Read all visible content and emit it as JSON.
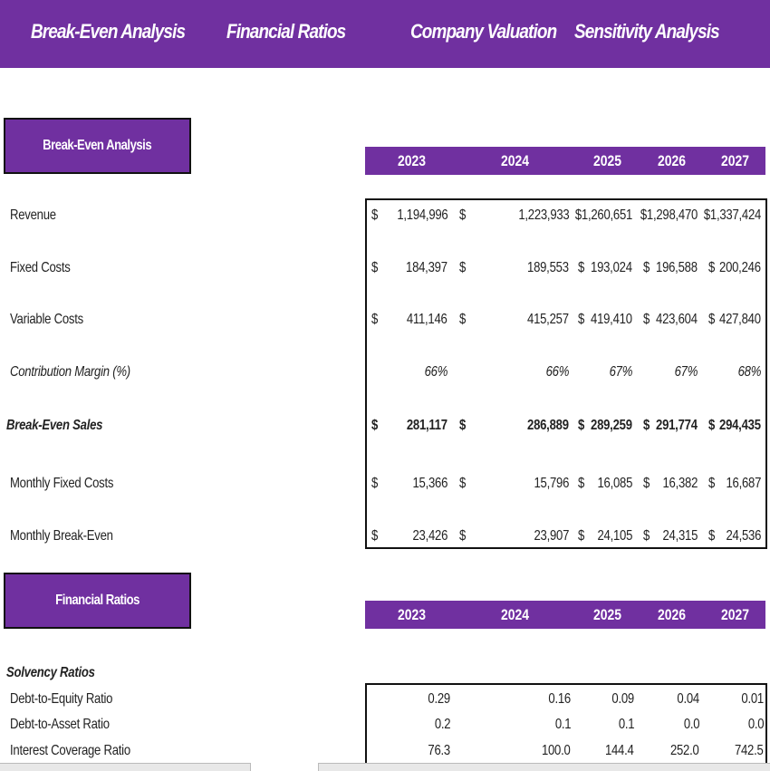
{
  "nav": {
    "items": [
      {
        "label": "Break-Even Analysis"
      },
      {
        "label": "Financial Ratios"
      },
      {
        "label": "Company Valuation"
      },
      {
        "label": "Sensitivity Analysis"
      }
    ]
  },
  "colors": {
    "accent": "#7030a0",
    "border": "#111111"
  },
  "break_even": {
    "section_title": "Break-Even Analysis",
    "years": [
      "2023",
      "2024",
      "2025",
      "2026",
      "2027"
    ],
    "rows": [
      {
        "label": "Revenue",
        "style": "normal",
        "currency": true,
        "values": [
          "1,194,996",
          "1,223,933",
          "$1,260,651",
          "$1,298,470",
          "$1,337,424"
        ]
      },
      {
        "label": "Fixed Costs",
        "style": "normal",
        "currency": true,
        "values": [
          "184,397",
          "189,553",
          "193,024",
          "196,588",
          "200,246"
        ]
      },
      {
        "label": "Variable Costs",
        "style": "normal",
        "currency": true,
        "values": [
          "411,146",
          "415,257",
          "419,410",
          "423,604",
          "427,840"
        ]
      },
      {
        "label": "Contribution Margin (%)",
        "style": "italic",
        "currency": false,
        "values": [
          "66%",
          "66%",
          "67%",
          "67%",
          "68%"
        ]
      },
      {
        "label": "Break-Even Sales",
        "style": "bold",
        "currency": true,
        "values": [
          "281,117",
          "286,889",
          "289,259",
          "291,774",
          "294,435"
        ]
      },
      {
        "label": "Monthly Fixed Costs",
        "style": "normal",
        "currency": true,
        "values": [
          "15,366",
          "15,796",
          "16,085",
          "16,382",
          "16,687"
        ]
      },
      {
        "label": "Monthly Break-Even",
        "style": "normal",
        "currency": true,
        "values": [
          "23,426",
          "23,907",
          "24,105",
          "24,315",
          "24,536"
        ]
      }
    ],
    "currency_symbol": "$"
  },
  "financial_ratios": {
    "section_title": "Financial Ratios",
    "years": [
      "2023",
      "2024",
      "2025",
      "2026",
      "2027"
    ],
    "group_title": "Solvency Ratios",
    "rows": [
      {
        "label": "Debt-to-Equity Ratio",
        "values": [
          "0.29",
          "0.16",
          "0.09",
          "0.04",
          "0.01"
        ]
      },
      {
        "label": "Debt-to-Asset Ratio",
        "values": [
          "0.2",
          "0.1",
          "0.1",
          "0.0",
          "0.0"
        ]
      },
      {
        "label": "Interest Coverage Ratio",
        "values": [
          "76.3",
          "100.0",
          "144.4",
          "252.0",
          "742.5"
        ]
      }
    ]
  }
}
